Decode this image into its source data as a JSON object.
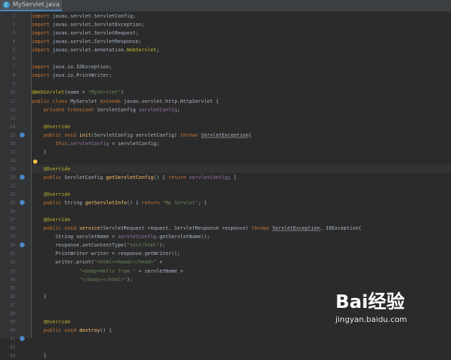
{
  "tab": {
    "label": "MyServlet.java",
    "icon": "class-icon"
  },
  "lines": [
    {
      "n": "1",
      "t": [
        [
          "k",
          "import "
        ],
        [
          "",
          "javax.servlet.ServletConfig;"
        ]
      ]
    },
    {
      "n": "2",
      "t": [
        [
          "k",
          "import "
        ],
        [
          "",
          "javax.servlet.ServletException;"
        ]
      ]
    },
    {
      "n": "3",
      "t": [
        [
          "k",
          "import "
        ],
        [
          "",
          "javax.servlet.ServletRequest;"
        ]
      ]
    },
    {
      "n": "4",
      "t": [
        [
          "k",
          "import "
        ],
        [
          "",
          "javax.servlet.ServletResponse;"
        ]
      ]
    },
    {
      "n": "5",
      "t": [
        [
          "k",
          "import "
        ],
        [
          "",
          "javax.servlet.annotation."
        ],
        [
          "a",
          "WebServlet"
        ],
        [
          "",
          ";"
        ]
      ]
    },
    {
      "n": "6",
      "t": []
    },
    {
      "n": "7",
      "t": [
        [
          "k",
          "import "
        ],
        [
          "",
          "java.io.IOException;"
        ]
      ]
    },
    {
      "n": "8",
      "t": [
        [
          "k",
          "import "
        ],
        [
          "",
          "java.io.PrintWriter;"
        ]
      ]
    },
    {
      "n": "9",
      "t": []
    },
    {
      "n": "10",
      "t": [
        [
          "a",
          "@WebServlet"
        ],
        [
          "",
          "(name = "
        ],
        [
          "s",
          "\"MyServlet\""
        ],
        [
          "",
          ")"
        ]
      ]
    },
    {
      "n": "11",
      "t": [
        [
          "k",
          "public class "
        ],
        [
          "",
          "MyServlet "
        ],
        [
          "k",
          "extends "
        ],
        [
          "",
          "javax.servlet.http.HttpServlet {"
        ]
      ]
    },
    {
      "n": "12",
      "t": [
        [
          "",
          "    "
        ],
        [
          "k",
          "private transient "
        ],
        [
          "",
          "ServletConfig "
        ],
        [
          "f",
          "servletConfig"
        ],
        [
          "",
          ";"
        ]
      ]
    },
    {
      "n": "13",
      "t": []
    },
    {
      "n": "14",
      "t": [
        [
          "",
          "    "
        ],
        [
          "a",
          "@Override"
        ]
      ]
    },
    {
      "n": "15",
      "t": [
        [
          "",
          "    "
        ],
        [
          "k",
          "public void "
        ],
        [
          "m",
          "init"
        ],
        [
          "",
          "(ServletConfig servletConfig) "
        ],
        [
          "k",
          "throws "
        ],
        [
          "u",
          "ServletException"
        ],
        [
          "",
          "{"
        ]
      ]
    },
    {
      "n": "16",
      "t": [
        [
          "",
          "        "
        ],
        [
          "k",
          "this"
        ],
        [
          "",
          "."
        ],
        [
          "f",
          "servletConfig"
        ],
        [
          "",
          " = servletConfig;"
        ]
      ]
    },
    {
      "n": "17",
      "t": [
        [
          "",
          "    }"
        ]
      ]
    },
    {
      "n": "18",
      "t": []
    },
    {
      "n": "19",
      "t": [
        [
          "",
          "    "
        ],
        [
          "a",
          "@Override"
        ]
      ]
    },
    {
      "n": "20",
      "t": [
        [
          "",
          "    "
        ],
        [
          "k",
          "public "
        ],
        [
          "",
          "ServletConfig "
        ],
        [
          "m",
          "getServletConfig"
        ],
        [
          "",
          "() { "
        ],
        [
          "k",
          "return "
        ],
        [
          "f",
          "servletConfig"
        ],
        [
          "",
          "; }"
        ]
      ]
    },
    {
      "n": "21",
      "t": []
    },
    {
      "n": "22",
      "t": [
        [
          "",
          "    "
        ],
        [
          "a",
          "@Override"
        ]
      ]
    },
    {
      "n": "25",
      "t": [
        [
          "",
          "    "
        ],
        [
          "k",
          "public "
        ],
        [
          "",
          "String "
        ],
        [
          "m",
          "getServletInfo"
        ],
        [
          "",
          "() { "
        ],
        [
          "k",
          "return "
        ],
        [
          "s",
          "\"My Servlet\""
        ],
        [
          "",
          "; }"
        ]
      ]
    },
    {
      "n": "26",
      "t": []
    },
    {
      "n": "27",
      "t": [
        [
          "",
          "    "
        ],
        [
          "a",
          "@Override"
        ]
      ]
    },
    {
      "n": "28",
      "t": [
        [
          "",
          "    "
        ],
        [
          "k",
          "public void "
        ],
        [
          "m",
          "service"
        ],
        [
          "",
          "(ServletRequest request, ServletResponse response) "
        ],
        [
          "k",
          "throws "
        ],
        [
          "u",
          "ServletException"
        ],
        [
          "",
          ", IOException{"
        ]
      ]
    },
    {
      "n": "29",
      "t": [
        [
          "",
          "        String servletName = "
        ],
        [
          "f",
          "servletConfig"
        ],
        [
          "",
          ".getServletName();"
        ]
      ]
    },
    {
      "n": "30",
      "t": [
        [
          "",
          "        response.setContentType("
        ],
        [
          "s",
          "\"text/html\""
        ],
        [
          "",
          ");"
        ]
      ]
    },
    {
      "n": "31",
      "t": [
        [
          "",
          "        PrintWriter writer = response.getWriter();"
        ]
      ]
    },
    {
      "n": "32",
      "t": [
        [
          "",
          "        writer.print("
        ],
        [
          "s",
          "\"<html><head></head>\""
        ],
        [
          "",
          " +"
        ]
      ]
    },
    {
      "n": "33",
      "t": [
        [
          "",
          "                "
        ],
        [
          "s",
          "\"<body>Hello from \""
        ],
        [
          "",
          " + servletName +"
        ]
      ]
    },
    {
      "n": "34",
      "t": [
        [
          "",
          "                "
        ],
        [
          "s",
          "\"</body></html>\""
        ],
        [
          "",
          ");"
        ]
      ]
    },
    {
      "n": "35",
      "t": []
    },
    {
      "n": "36",
      "t": [
        [
          "",
          "    }"
        ]
      ]
    },
    {
      "n": "37",
      "t": []
    },
    {
      "n": "38",
      "t": []
    },
    {
      "n": "39",
      "t": [
        [
          "",
          "    "
        ],
        [
          "a",
          "@Override"
        ]
      ]
    },
    {
      "n": "40",
      "t": [
        [
          "",
          "    "
        ],
        [
          "k",
          "public void "
        ],
        [
          "m",
          "destroy"
        ],
        [
          "",
          "() {"
        ]
      ]
    },
    {
      "n": "41",
      "t": []
    },
    {
      "n": "42",
      "t": []
    },
    {
      "n": "43",
      "t": [
        [
          "",
          "    }"
        ]
      ]
    }
  ],
  "gutter_markers": [
    {
      "line_index": 14,
      "kind": "override-marker-icon",
      "color": "#4a88c7"
    },
    {
      "line_index": 19,
      "kind": "override-marker-icon",
      "color": "#4a88c7"
    },
    {
      "line_index": 22,
      "kind": "override-marker-icon",
      "color": "#4a88c7"
    },
    {
      "line_index": 27,
      "kind": "override-marker-icon",
      "color": "#4a88c7"
    },
    {
      "line_index": 38,
      "kind": "override-marker-icon",
      "color": "#4a88c7"
    }
  ],
  "current_line_index": 18,
  "watermark": {
    "logo": "Bai经验",
    "sub": "jingyan.baidu.com"
  },
  "colors": {
    "background": "#2b2b2b",
    "keyword": "#cc7832",
    "string": "#6a8759",
    "annotation": "#bbb529",
    "field": "#9876aa",
    "method": "#ffc66d"
  }
}
